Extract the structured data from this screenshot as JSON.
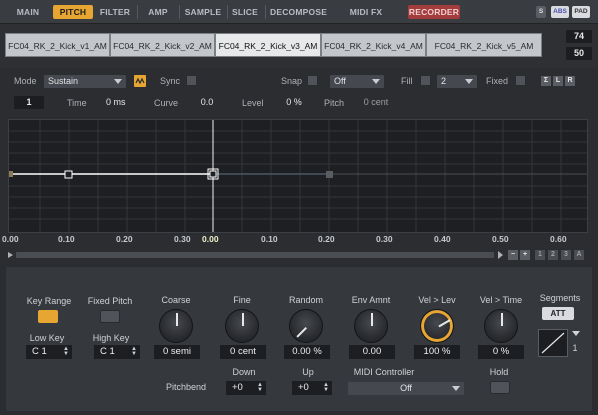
{
  "tabs": [
    "MAIN",
    "PITCH",
    "FILTER",
    "AMP",
    "SAMPLE",
    "SLICE",
    "DECOMPOSE",
    "MIDI FX",
    "RECORDER"
  ],
  "active_tab": "PITCH",
  "mini_buttons": {
    "s": "S",
    "abs": "ABS",
    "pad": "PAD"
  },
  "zones": [
    "FC04_RK_2_Kick_v1_AM",
    "FC04_RK_2_Kick_v2_AM",
    "FC04_RK_2_Kick_v3_AM",
    "FC04_RK_2_Kick_v4_AM",
    "FC04_RK_2_Kick_v5_AM"
  ],
  "selected_zone_index": 2,
  "velocity_top": "74",
  "velocity_bottom": "50",
  "envelope": {
    "mode_label": "Mode",
    "mode_value": "Sustain",
    "sync_label": "Sync",
    "snap_label": "Snap",
    "snap_value": "Off",
    "fill_label": "Fill",
    "fill_value": "2",
    "fixed_label": "Fixed",
    "sum_buttons": [
      "Σ",
      "L",
      "R"
    ],
    "node_index": "1",
    "time_label": "Time",
    "time_value": "0 ms",
    "curve_label": "Curve",
    "curve_value": "0.0",
    "level_label": "Level",
    "level_value": "0 %",
    "pitch_label": "Pitch",
    "pitch_value": "0 cent"
  },
  "axis_ticks": [
    "0.00",
    "0.10",
    "0.20",
    "0.30",
    "0.00",
    "0.10",
    "0.20",
    "0.30",
    "0.40",
    "0.50",
    "0.60"
  ],
  "page_buttons": [
    "1",
    "2",
    "3",
    "A"
  ],
  "zoom_minus": "−",
  "zoom_plus": "+",
  "lower": {
    "key_range_label": "Key Range",
    "fixed_pitch_label": "Fixed Pitch",
    "low_key_label": "Low Key",
    "low_key_value": "C 1",
    "high_key_label": "High Key",
    "high_key_value": "C 1",
    "coarse_label": "Coarse",
    "coarse_value": "0 semi",
    "fine_label": "Fine",
    "fine_value": "0 cent",
    "random_label": "Random",
    "random_value": "0.00 %",
    "env_amnt_label": "Env Amnt",
    "env_amnt_value": "0.00",
    "vel_lev_label": "Vel > Lev",
    "vel_lev_value": "100 %",
    "vel_time_label": "Vel > Time",
    "vel_time_value": "0 %",
    "segments_label": "Segments",
    "att_label": "ATT",
    "segment_count": "1",
    "pitchbend_label": "Pitchbend",
    "down_label": "Down",
    "down_value": "+0",
    "up_label": "Up",
    "up_value": "+0",
    "midi_controller_label": "MIDI Controller",
    "midi_controller_value": "Off",
    "hold_label": "Hold"
  },
  "colors": {
    "accent": "#e7a532",
    "record": "#a33c3c",
    "envelope_line": "#ffffff"
  }
}
